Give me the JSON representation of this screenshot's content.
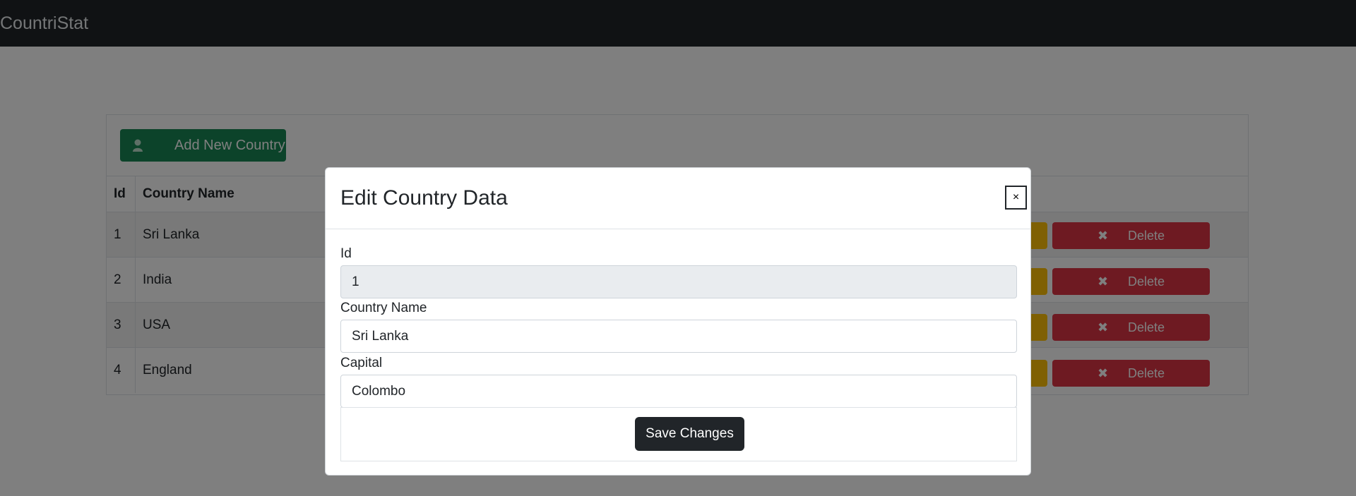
{
  "navbar": {
    "brand": "CountriStat"
  },
  "toolbar": {
    "add_label": "Add New Country",
    "add_icon": "user-icon"
  },
  "table": {
    "headers": [
      "Id",
      "Country Name"
    ],
    "rows": [
      {
        "id": "1",
        "name": "Sri Lanka",
        "delete_label": "Delete"
      },
      {
        "id": "2",
        "name": "India",
        "delete_label": "Delete"
      },
      {
        "id": "3",
        "name": "USA",
        "delete_label": "Delete"
      },
      {
        "id": "4",
        "name": "England",
        "delete_label": "Delete"
      }
    ]
  },
  "modal": {
    "title": "Edit Country Data",
    "close_label": "×",
    "fields": {
      "id": {
        "label": "Id",
        "value": "1"
      },
      "name": {
        "label": "Country Name",
        "value": "Sri Lanka"
      },
      "capital": {
        "label": "Capital",
        "value": "Colombo"
      }
    },
    "save_label": "Save Changes"
  },
  "colors": {
    "navbar": "#212529",
    "success": "#198754",
    "danger": "#dc3545",
    "warning": "#ffc107",
    "dark_button": "#212529"
  }
}
